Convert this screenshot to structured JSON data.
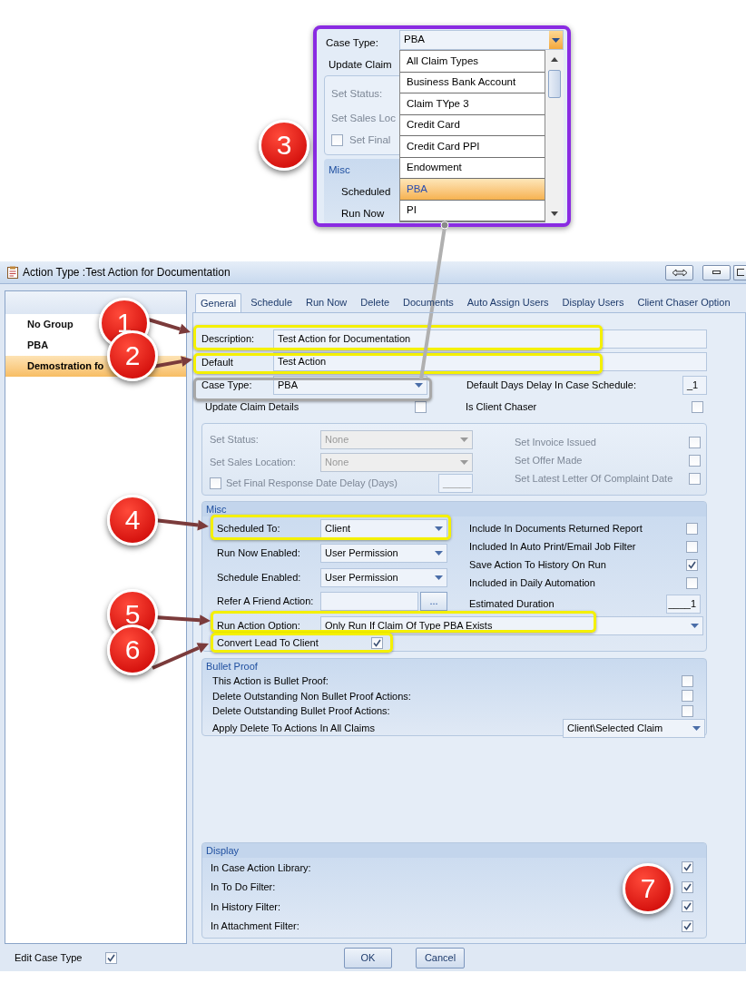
{
  "callout": {
    "label": "Case Type:",
    "value": "PBA",
    "background_labels": [
      "Update Claim",
      "Set Status:",
      "Set Sales Loc",
      "Set Final",
      "Misc",
      "Scheduled",
      "Run Now"
    ],
    "final_checkbox": {
      "checked": false
    },
    "options": [
      {
        "label": "All Claim Types",
        "selected": false
      },
      {
        "label": "Business Bank Account",
        "selected": false
      },
      {
        "label": "Claim TYpe 3",
        "selected": false
      },
      {
        "label": "Credit Card",
        "selected": false
      },
      {
        "label": "Credit Card PPI",
        "selected": false
      },
      {
        "label": "Endowment",
        "selected": false
      },
      {
        "label": "PBA",
        "selected": true
      },
      {
        "label": "PI",
        "selected": false
      }
    ]
  },
  "window": {
    "title": "Action Type :Test Action for Documentation"
  },
  "groups": [
    {
      "label": "No Group",
      "selected": false
    },
    {
      "label": "PBA",
      "selected": false
    },
    {
      "label": "Demostration  fo",
      "selected": true
    }
  ],
  "tabs": [
    {
      "label": "General",
      "selected": true
    },
    {
      "label": "Schedule",
      "selected": false
    },
    {
      "label": "Run Now",
      "selected": false
    },
    {
      "label": "Delete",
      "selected": false
    },
    {
      "label": "Documents",
      "selected": false
    },
    {
      "label": "Auto Assign Users",
      "selected": false
    },
    {
      "label": "Display Users",
      "selected": false
    },
    {
      "label": "Client Chaser Option",
      "selected": false
    }
  ],
  "details": {
    "description": {
      "label": "Description:",
      "value": "Test Action for Documentation"
    },
    "default_action": {
      "label": "Default",
      "value": "Test Action"
    },
    "case_type": {
      "label": "Case Type:",
      "value": "PBA"
    },
    "default_days_delay": {
      "label": "Default Days Delay In Case Schedule:",
      "value": "_1"
    },
    "update_claim_details": {
      "label": "Update Claim Details",
      "checked": false
    },
    "is_client_chaser": {
      "label": "Is Client Chaser",
      "checked": false
    }
  },
  "status": {
    "disabled": true,
    "set_status": {
      "label": "Set Status:",
      "value": "None"
    },
    "set_sales_location": {
      "label": "Set Sales Location:",
      "value": "None"
    },
    "final_response": {
      "label": "Set Final Response Date Delay (Days)",
      "checked": false,
      "value": "_____"
    },
    "checks": [
      {
        "label": "Set Invoice Issued",
        "checked": false
      },
      {
        "label": "Set Offer Made",
        "checked": false
      },
      {
        "label": "Set Latest Letter Of Complaint Date",
        "checked": false
      }
    ]
  },
  "misc": {
    "title": "Misc",
    "fields": [
      {
        "label": "Scheduled To:",
        "value": "Client"
      },
      {
        "label": "Run Now Enabled:",
        "value": "User Permission"
      },
      {
        "label": "Schedule Enabled:",
        "value": "User Permission"
      }
    ],
    "refer_a_friend": {
      "label": "Refer A Friend Action:",
      "button": "..."
    },
    "run_action_option": {
      "label": "Run Action Option:",
      "value": "Only Run If Claim Of Type PBA Exists"
    },
    "convert_lead": {
      "label": "Convert Lead To Client",
      "checked": true
    },
    "checks": [
      {
        "label": "Include In Documents Returned Report",
        "checked": false
      },
      {
        "label": "Included In Auto Print/Email Job Filter",
        "checked": false
      },
      {
        "label": "Save Action To History On Run",
        "checked": true
      },
      {
        "label": "Included in Daily Automation",
        "checked": false
      }
    ],
    "estimated_duration": {
      "label": "Estimated Duration",
      "value": "____1"
    }
  },
  "bullet_proof": {
    "title": "Bullet Proof",
    "checks": [
      {
        "label": "This Action is Bullet Proof:",
        "checked": false
      },
      {
        "label": "Delete Outstanding Non Bullet Proof Actions:",
        "checked": false
      },
      {
        "label": "Delete Outstanding Bullet Proof Actions:",
        "checked": false
      }
    ],
    "apply_delete": {
      "label": "Apply Delete To Actions In All Claims",
      "value": "Client\\Selected Claim"
    }
  },
  "display": {
    "title": "Display",
    "checks": [
      {
        "label": "In Case Action Library:",
        "checked": true
      },
      {
        "label": "In To Do Filter:",
        "checked": true
      },
      {
        "label": "In History Filter:",
        "checked": true
      },
      {
        "label": "In Attachment Filter:",
        "checked": true
      }
    ]
  },
  "footer": {
    "edit_case_type": {
      "label": "Edit Case Type",
      "checked": true
    },
    "buttons": [
      "OK",
      "Cancel"
    ]
  },
  "annotations": [
    {
      "number": "1"
    },
    {
      "number": "2"
    },
    {
      "number": "3"
    },
    {
      "number": "4"
    },
    {
      "number": "5"
    },
    {
      "number": "6"
    },
    {
      "number": "7"
    }
  ]
}
